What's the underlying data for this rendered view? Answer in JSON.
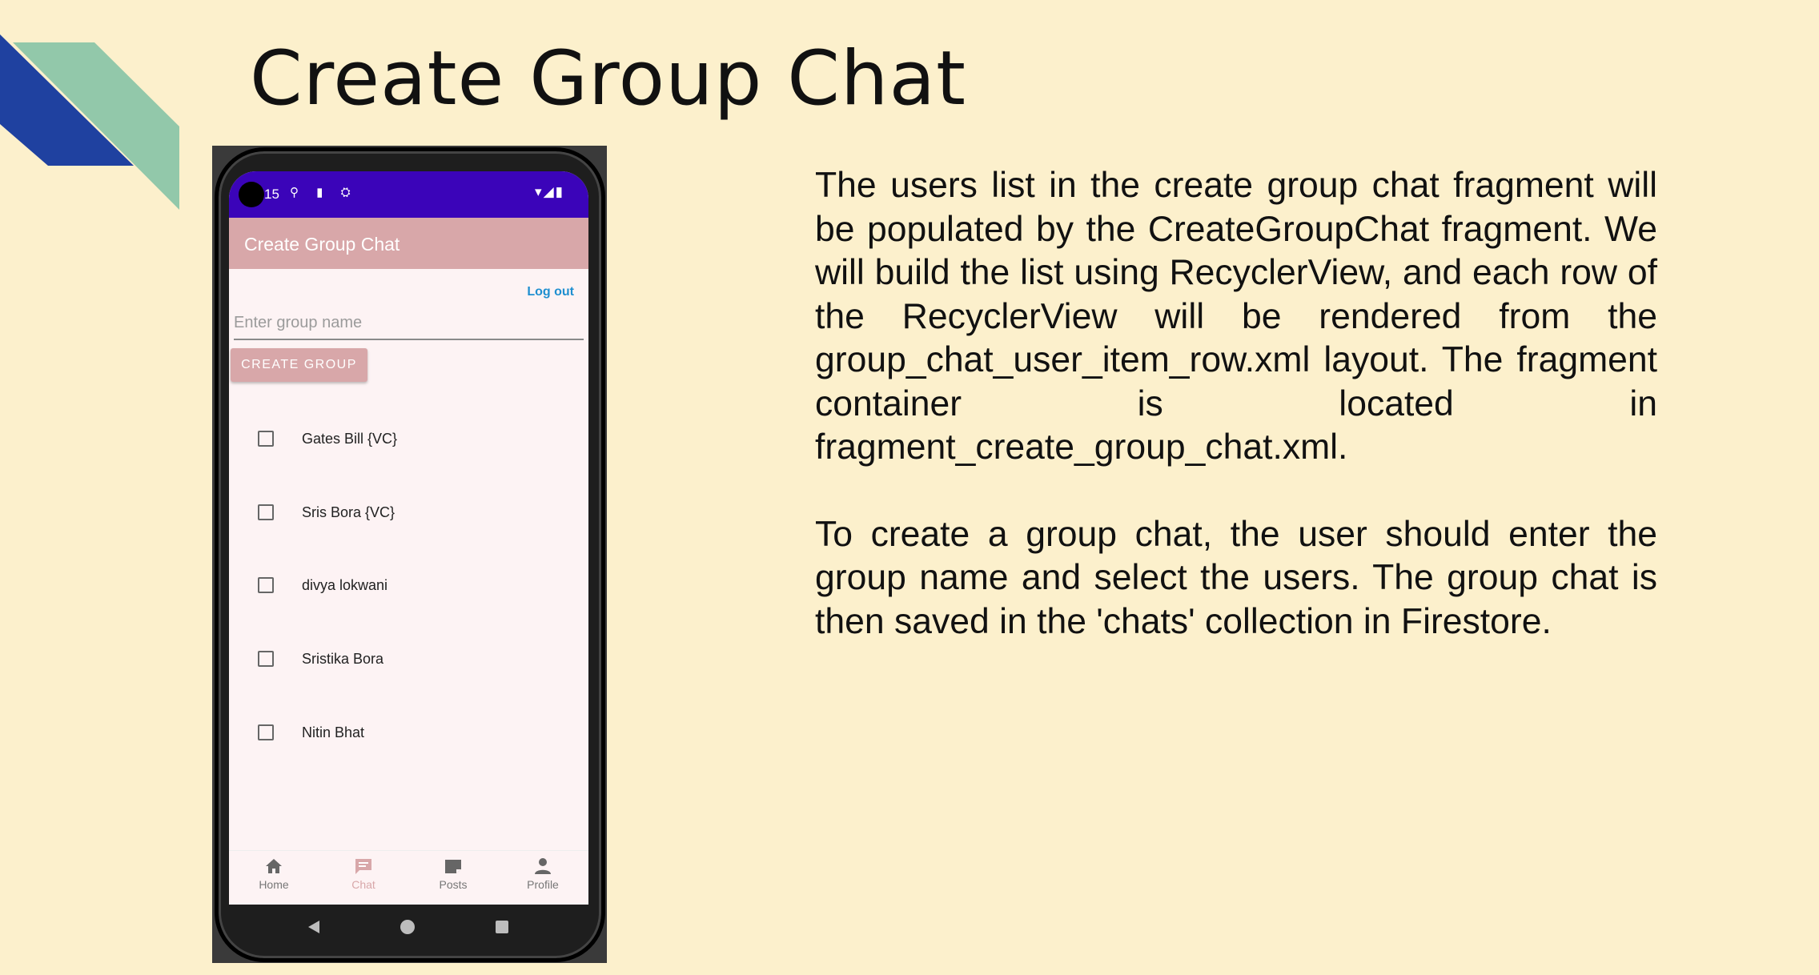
{
  "slide": {
    "title": "Create Group Chat",
    "paragraph1": "The users list in the create group chat fragment will be populated by the CreateGroupChat fragment. We will build the list using RecyclerView, and each row of the RecyclerView will be rendered from the group_chat_user_item_row.xml layout. The fragment container is located in fragment_create_group_chat.xml.",
    "paragraph2": "To create a group chat, the user should enter the group name and select the users. The group chat is then saved in the 'chats' collection in Firestore.",
    "colors": {
      "background": "#fcf0cc",
      "deco_blue": "#1f41a0",
      "deco_green": "#92c8aa"
    }
  },
  "phone": {
    "status_bar": {
      "time": "15",
      "left_icons": "⚲ ▮ ⛭",
      "right_icons": "▾◢▮",
      "color": "#3b04b9"
    },
    "app_bar": {
      "title": "Create Group Chat",
      "color": "#d8a7a9"
    },
    "logout_label": "Log out",
    "group_name_placeholder": "Enter group name",
    "create_button_label": "CREATE GROUP",
    "users": [
      {
        "name": "Gates Bill {VC}",
        "checked": false
      },
      {
        "name": "Sris Bora {VC}",
        "checked": false
      },
      {
        "name": "divya lokwani",
        "checked": false
      },
      {
        "name": "Sristika Bora",
        "checked": false
      },
      {
        "name": "Nitin Bhat",
        "checked": false
      }
    ],
    "bottom_nav": [
      {
        "label": "Home",
        "icon": "home-icon",
        "active": false
      },
      {
        "label": "Chat",
        "icon": "chat-icon",
        "active": true
      },
      {
        "label": "Posts",
        "icon": "posts-icon",
        "active": false
      },
      {
        "label": "Profile",
        "icon": "profile-icon",
        "active": false
      }
    ]
  }
}
